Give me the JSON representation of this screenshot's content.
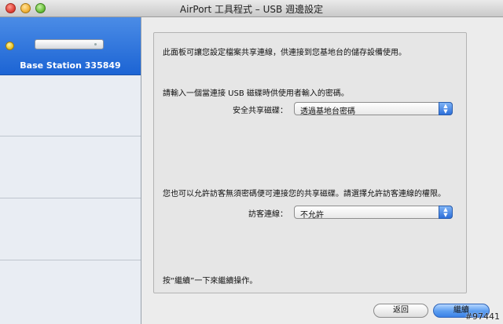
{
  "window": {
    "title": "AirPort 工具程式 – USB 週邊設定"
  },
  "sidebar": {
    "items": [
      {
        "label": "Base Station 335849",
        "selected": true,
        "status": "yellow"
      }
    ]
  },
  "panel": {
    "intro": "此面板可讓您設定檔案共享連線，供連接到您基地台的儲存設備使用。",
    "password_prompt": "請輸入一個當連接 USB 磁碟時供使用者輸入的密碼。",
    "secure_disk_label": "安全共享磁碟：",
    "secure_disk_value": "透過基地台密碼",
    "guest_prompt": "您也可以允許訪客無須密碼便可連接您的共享磁碟。請選擇允許訪客連線的權限。",
    "guest_access_label": "訪客連線：",
    "guest_access_value": "不允許",
    "continue_hint": "按“繼續”一下來繼續操作。"
  },
  "buttons": {
    "back": "返回",
    "continue": "繼續"
  },
  "watermark": "#97441",
  "colors": {
    "selection": "#2f74dc",
    "default_button": "#4a8eea"
  }
}
